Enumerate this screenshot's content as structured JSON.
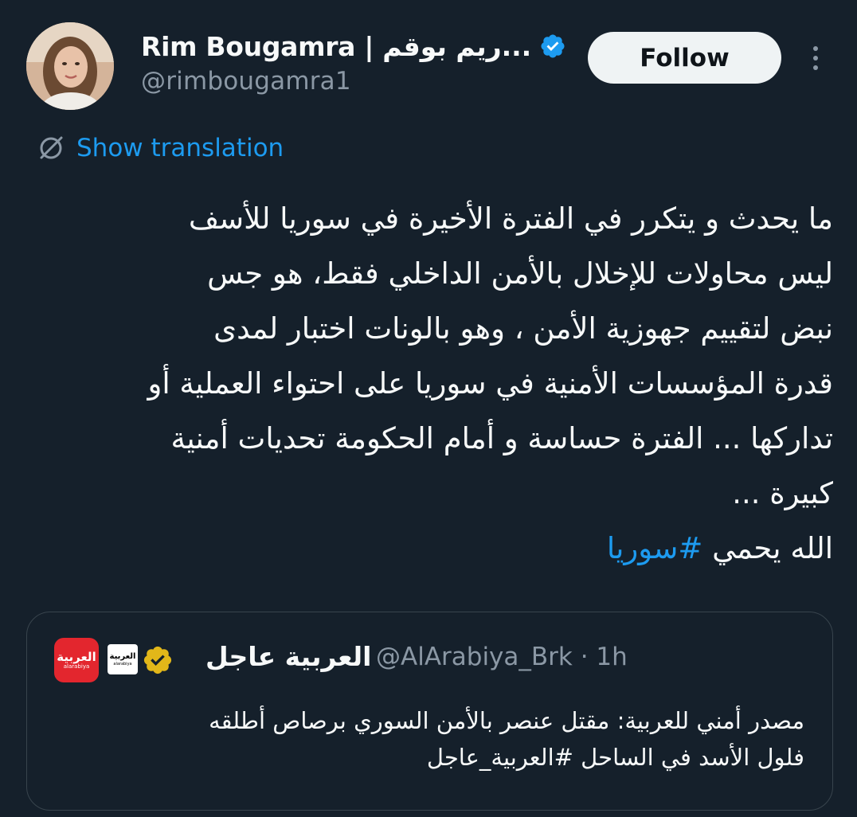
{
  "author": {
    "display_name": "Rim Bougamra | ريم بوقم...",
    "handle": "@rimbougamra1",
    "verified": true
  },
  "actions": {
    "follow_label": "Follow",
    "more_icon": "more-vertical-icon"
  },
  "translation": {
    "label": "Show translation",
    "icon": "translate-globe-icon"
  },
  "tweet": {
    "lines": [
      "ما يحدث و يتكرر في الفترة الأخيرة في سوريا للأسف",
      "ليس محاولات للإخلال بالأمن الداخلي فقط، هو جس",
      "نبض لتقييم جهوزية الأمن ، وهو بالونات اختبار لمدى",
      "قدرة المؤسسات الأمنية في سوريا على احتواء العملية أو",
      "تداركها ... الفترة حساسة و أمام الحكومة تحديات أمنية",
      "كبيرة ..."
    ],
    "closing_text": "الله يحمي ",
    "hashtag": "#سوريا"
  },
  "quoted_tweet": {
    "name": "العربية عاجل",
    "handle": "@AlArabiya_Brk · 1h",
    "logo_text_ar": "العربية",
    "logo_text_lat": "alarabiya",
    "lines": [
      "مصدر أمني للعربية: مقتل عنصر بالأمن السوري برصاص أطلقه",
      "فلول الأسد في الساحل #العربية_عاجل"
    ]
  },
  "colors": {
    "background": "#15202b",
    "accent": "#1d9bf0",
    "text_primary": "#f7f9f9",
    "text_secondary": "#8b98a5",
    "border": "#38444d",
    "gold_badge": "#e2b719"
  }
}
